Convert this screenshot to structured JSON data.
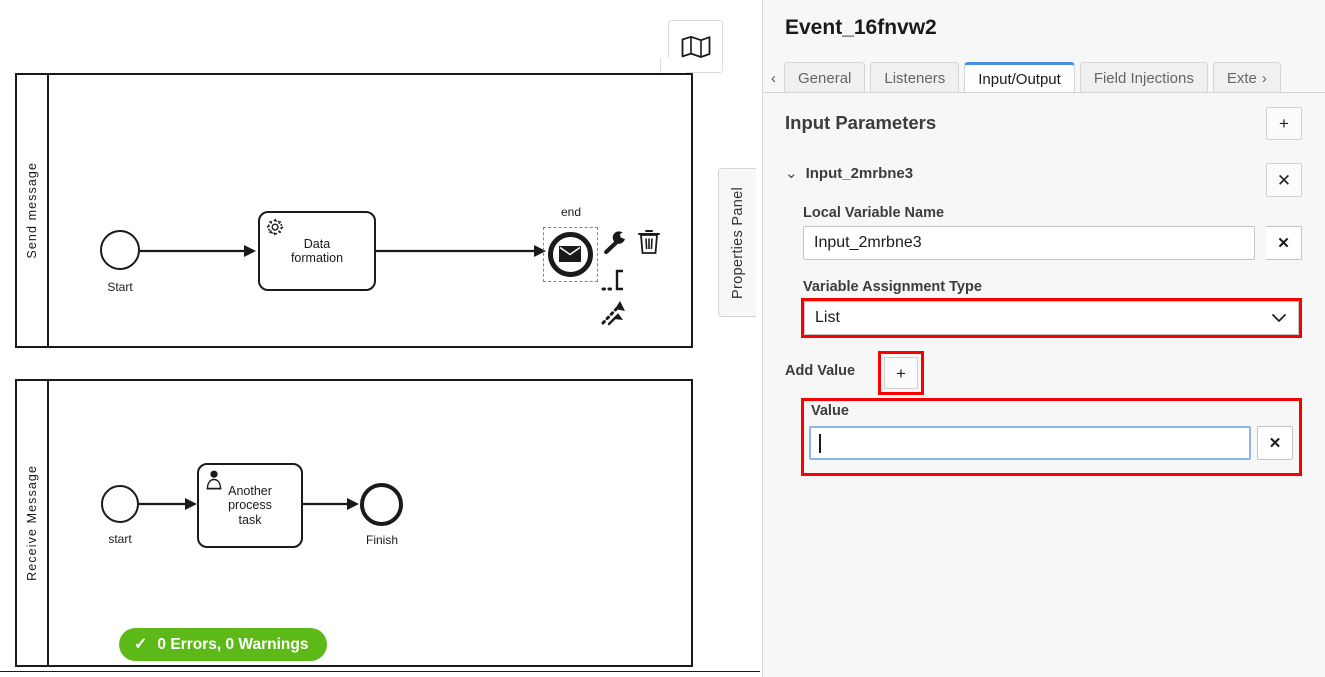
{
  "canvas": {
    "minimap_toggle_icon": "map-icon",
    "properties_panel_tab_label": "Properties Panel",
    "pools": [
      {
        "name": "Send message",
        "elements": [
          {
            "type": "start-event",
            "label": "Start"
          },
          {
            "type": "service-task",
            "label": "Data\nformation",
            "icon": "gear-icon"
          },
          {
            "type": "message-end-event",
            "label": "end",
            "icon": "envelope-icon",
            "selected": true
          }
        ]
      },
      {
        "name": "Receive Message",
        "elements": [
          {
            "type": "start-event",
            "label": "start"
          },
          {
            "type": "user-task",
            "label": "Another\nprocess\ntask",
            "icon": "user-icon"
          },
          {
            "type": "end-event",
            "label": "Finish"
          }
        ]
      }
    ],
    "context_pad": [
      {
        "icon": "wrench-icon",
        "name": "change-type"
      },
      {
        "icon": "trash-icon",
        "name": "delete-element"
      },
      {
        "icon": "text-annotation-icon",
        "name": "append-text-annotation"
      },
      {
        "icon": "connect-arrow-icon",
        "name": "append-connection"
      }
    ],
    "status_badge": {
      "icon": "check-icon",
      "text": "0 Errors, 0 Warnings",
      "color": "#5cb917"
    }
  },
  "panel": {
    "title": "Event_16fnvw2",
    "tabs": {
      "prev_chevron": "‹",
      "next_chevron": "›",
      "items": [
        {
          "label": "General",
          "active": false
        },
        {
          "label": "Listeners",
          "active": false
        },
        {
          "label": "Input/Output",
          "active": true
        },
        {
          "label": "Field Injections",
          "active": false
        },
        {
          "label": "Exte",
          "active": false,
          "truncated": true
        }
      ]
    },
    "section": {
      "heading": "Input Parameters",
      "add_button_label": "+",
      "parameter": {
        "expand_chevron": "⌄",
        "name": "Input_2mrbne3",
        "remove_button_label": "✕",
        "local_variable_name": {
          "label": "Local Variable Name",
          "value": "Input_2mrbne3",
          "clear_button_label": "✕"
        },
        "variable_assignment_type": {
          "label": "Variable Assignment Type",
          "value": "List",
          "caret": "⌄"
        },
        "add_value": {
          "label": "Add Value",
          "button_label": "+"
        },
        "value_entry": {
          "label": "Value",
          "value": "",
          "clear_button_label": "✕"
        }
      }
    },
    "highlight_color": "#fb0000",
    "accent_color": "#4a90e2"
  }
}
